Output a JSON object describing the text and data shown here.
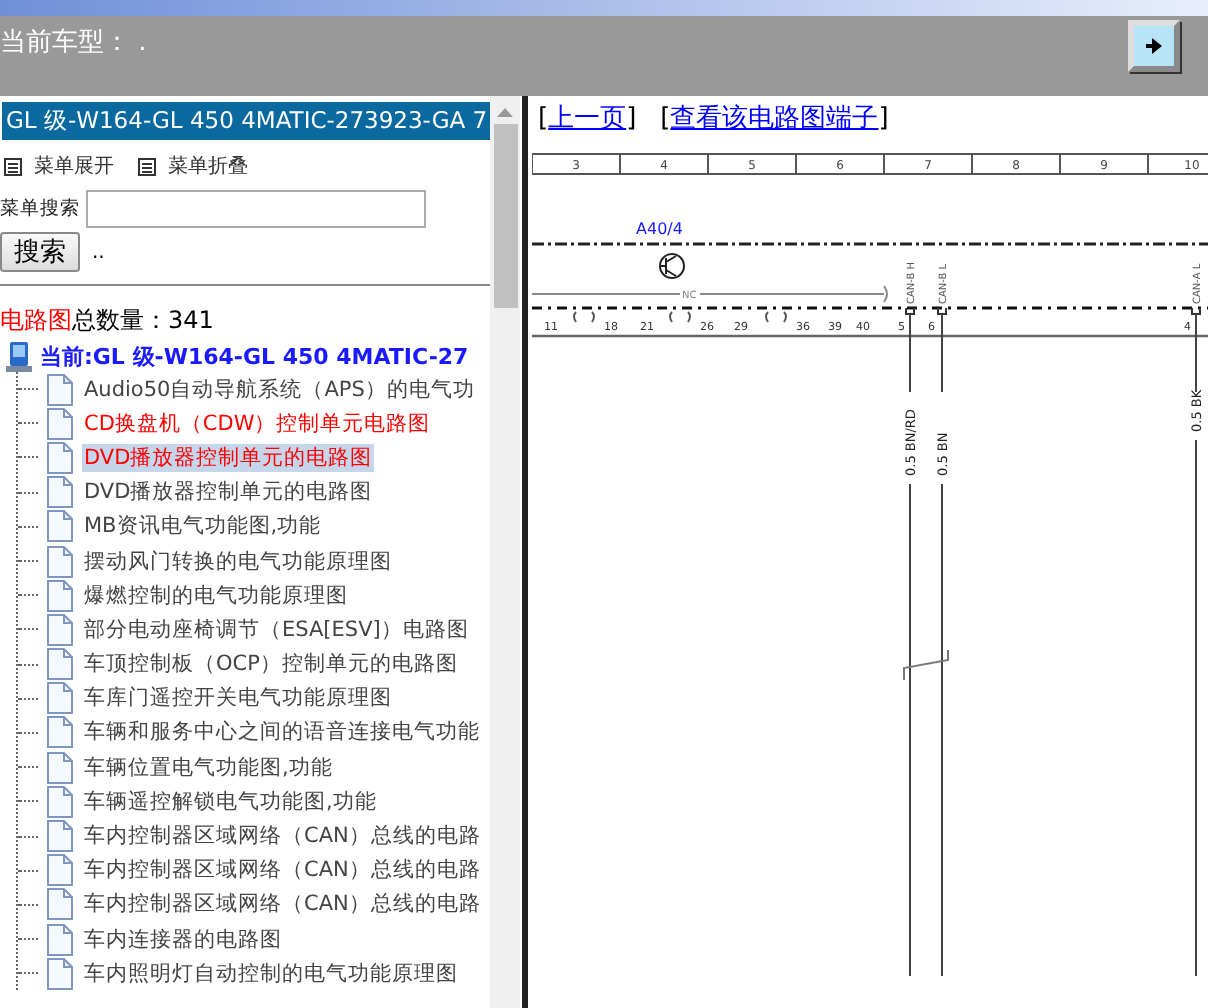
{
  "header": {
    "label": "当前车型：",
    "value": "."
  },
  "sidebar": {
    "title": "GL 级-W164-GL 450 4MATIC-273923-GA 7",
    "expand": "菜单展开",
    "collapse": "菜单折叠",
    "search_label": "菜单搜索",
    "search_button": "搜索",
    "search_hint": "..",
    "count_prefix": "电路图",
    "count_label": "总数量：",
    "count": "341",
    "current": "当前:GL 级-W164-GL 450 4MATIC-27",
    "items": [
      {
        "label": "Audio50自动导航系统（APS）的电气功",
        "color": "#444444",
        "selected": false
      },
      {
        "label": "CD换盘机（CDW）控制单元电路图",
        "color": "#ff0000",
        "selected": false
      },
      {
        "label": "DVD播放器控制单元的电路图",
        "color": "#ff0000",
        "selected": true
      },
      {
        "label": "DVD播放器控制单元的电路图",
        "color": "#444444",
        "selected": false
      },
      {
        "label": "MB资讯电气功能图,功能",
        "color": "#444444",
        "selected": false
      },
      {
        "label": "摆动风门转换的电气功能原理图",
        "color": "#444444",
        "selected": false
      },
      {
        "label": "爆燃控制的电气功能原理图",
        "color": "#444444",
        "selected": false
      },
      {
        "label": "部分电动座椅调节（ESA[ESV]）电路图",
        "color": "#444444",
        "selected": false
      },
      {
        "label": "车顶控制板（OCP）控制单元的电路图",
        "color": "#444444",
        "selected": false
      },
      {
        "label": "车库门遥控开关电气功能原理图",
        "color": "#444444",
        "selected": false
      },
      {
        "label": "车辆和服务中心之间的语音连接电气功能",
        "color": "#444444",
        "selected": false
      },
      {
        "label": "车辆位置电气功能图,功能",
        "color": "#444444",
        "selected": false
      },
      {
        "label": "车辆遥控解锁电气功能图,功能",
        "color": "#444444",
        "selected": false
      },
      {
        "label": "车内控制器区域网络（CAN）总线的电路",
        "color": "#444444",
        "selected": false
      },
      {
        "label": "车内控制器区域网络（CAN）总线的电路",
        "color": "#444444",
        "selected": false
      },
      {
        "label": "车内控制器区域网络（CAN）总线的电路",
        "color": "#444444",
        "selected": false
      },
      {
        "label": "车内连接器的电路图",
        "color": "#444444",
        "selected": false
      },
      {
        "label": "车内照明灯自动控制的电气功能原理图",
        "color": "#444444",
        "selected": false
      }
    ]
  },
  "content": {
    "links": [
      {
        "open": "[",
        "text": "上一页",
        "close": "]"
      },
      {
        "open": "[",
        "text": "查看该电路图端子",
        "close": "]"
      }
    ],
    "diagram": {
      "columns": [
        "3",
        "4",
        "5",
        "6",
        "7",
        "8",
        "9",
        "10"
      ],
      "component": "A40/4",
      "nc": "NC",
      "pins": [
        "11",
        "18",
        "21",
        "26",
        "29",
        "36",
        "39",
        "40",
        "5",
        "6",
        "4"
      ],
      "wires": [
        {
          "signal": "CAN-B H",
          "wire": "0.5 BN/RD"
        },
        {
          "signal": "CAN-B L",
          "wire": "0.5 BN"
        },
        {
          "signal": "CAN-A L",
          "wire": "0.5 BK"
        }
      ]
    }
  }
}
